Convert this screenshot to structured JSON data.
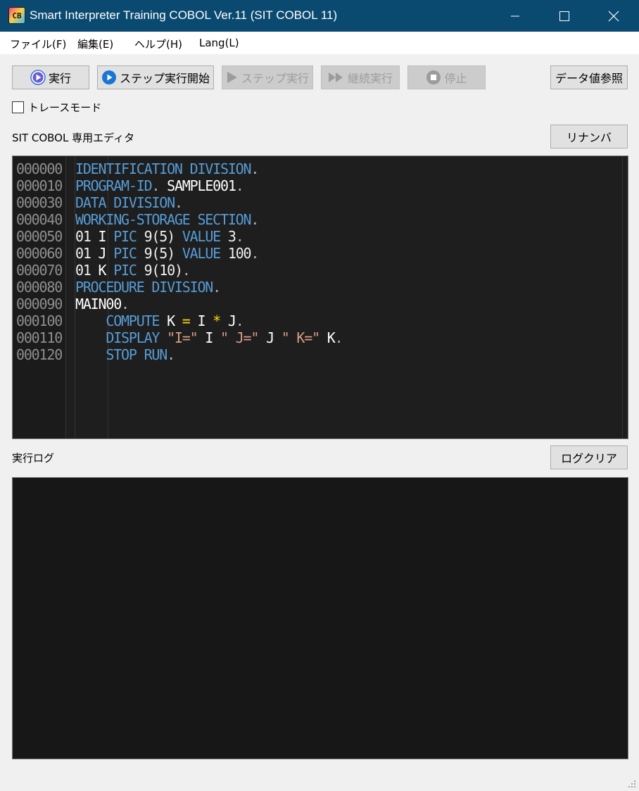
{
  "window": {
    "title": "Smart Interpreter Training COBOL Ver.11 (SIT COBOL 11)",
    "icon_text": "CB",
    "icon": "app-icon"
  },
  "menu": {
    "items": [
      "ファイル(F)",
      "編集(E)",
      "ヘルプ(H)",
      "Lang(L)"
    ]
  },
  "toolbar": {
    "run_label": "実行",
    "step_start_label": "ステップ実行開始",
    "step_label": "ステップ実行",
    "continue_label": "継続実行",
    "stop_label": "停止",
    "data_view_label": "データ値参照"
  },
  "trace": {
    "label": "トレースモード",
    "checked": false
  },
  "editor": {
    "label": "SIT COBOL 専用エディタ",
    "renumber_label": "リナンバ",
    "line_numbers": [
      "000000",
      "000010",
      "000030",
      "000040",
      "000050",
      "000060",
      "000070",
      "000080",
      "000090",
      "000100",
      "000110",
      "000120"
    ],
    "lines": [
      [
        [
          "kw",
          "IDENTIFICATION DIVISION"
        ],
        [
          "pun",
          "."
        ]
      ],
      [
        [
          "kw",
          "PROGRAM-ID"
        ],
        [
          "pun",
          ". "
        ],
        [
          "id",
          "SAMPLE001"
        ],
        [
          "pun",
          "."
        ]
      ],
      [
        [
          "kw",
          "DATA DIVISION"
        ],
        [
          "pun",
          "."
        ]
      ],
      [
        [
          "kw",
          "WORKING-STORAGE SECTION"
        ],
        [
          "pun",
          "."
        ]
      ],
      [
        [
          "num",
          "01 "
        ],
        [
          "id",
          "I "
        ],
        [
          "kw",
          "PIC "
        ],
        [
          "num",
          "9(5) "
        ],
        [
          "kw",
          "VALUE "
        ],
        [
          "num",
          "3"
        ],
        [
          "pun",
          "."
        ]
      ],
      [
        [
          "num",
          "01 "
        ],
        [
          "id",
          "J "
        ],
        [
          "kw",
          "PIC "
        ],
        [
          "num",
          "9(5) "
        ],
        [
          "kw",
          "VALUE "
        ],
        [
          "num",
          "100"
        ],
        [
          "pun",
          "."
        ]
      ],
      [
        [
          "num",
          "01 "
        ],
        [
          "id",
          "K "
        ],
        [
          "kw",
          "PIC "
        ],
        [
          "num",
          "9(10)"
        ],
        [
          "pun",
          "."
        ]
      ],
      [
        [
          "kw",
          "PROCEDURE DIVISION"
        ],
        [
          "pun",
          "."
        ]
      ],
      [
        [
          "id",
          "MAIN00"
        ],
        [
          "pun",
          "."
        ]
      ],
      [
        [
          "id",
          "    "
        ],
        [
          "kw",
          "COMPUTE "
        ],
        [
          "id",
          "K "
        ],
        [
          "op",
          "= "
        ],
        [
          "id",
          "I "
        ],
        [
          "op",
          "* "
        ],
        [
          "id",
          "J"
        ],
        [
          "pun",
          "."
        ]
      ],
      [
        [
          "id",
          "    "
        ],
        [
          "kw",
          "DISPLAY "
        ],
        [
          "str",
          "\"I=\" "
        ],
        [
          "id",
          "I "
        ],
        [
          "str",
          "\" J=\" "
        ],
        [
          "id",
          "J "
        ],
        [
          "str",
          "\" K=\" "
        ],
        [
          "id",
          "K"
        ],
        [
          "pun",
          "."
        ]
      ],
      [
        [
          "id",
          "    "
        ],
        [
          "kw",
          "STOP RUN"
        ],
        [
          "pun",
          "."
        ]
      ]
    ],
    "colors": {
      "keyword": "#569cd6",
      "identifier": "#ffffff",
      "operator": "#ffd700",
      "string": "#d69d85",
      "background": "#1e1e1e"
    }
  },
  "log": {
    "label": "実行ログ",
    "clear_label": "ログクリア",
    "content": ""
  }
}
